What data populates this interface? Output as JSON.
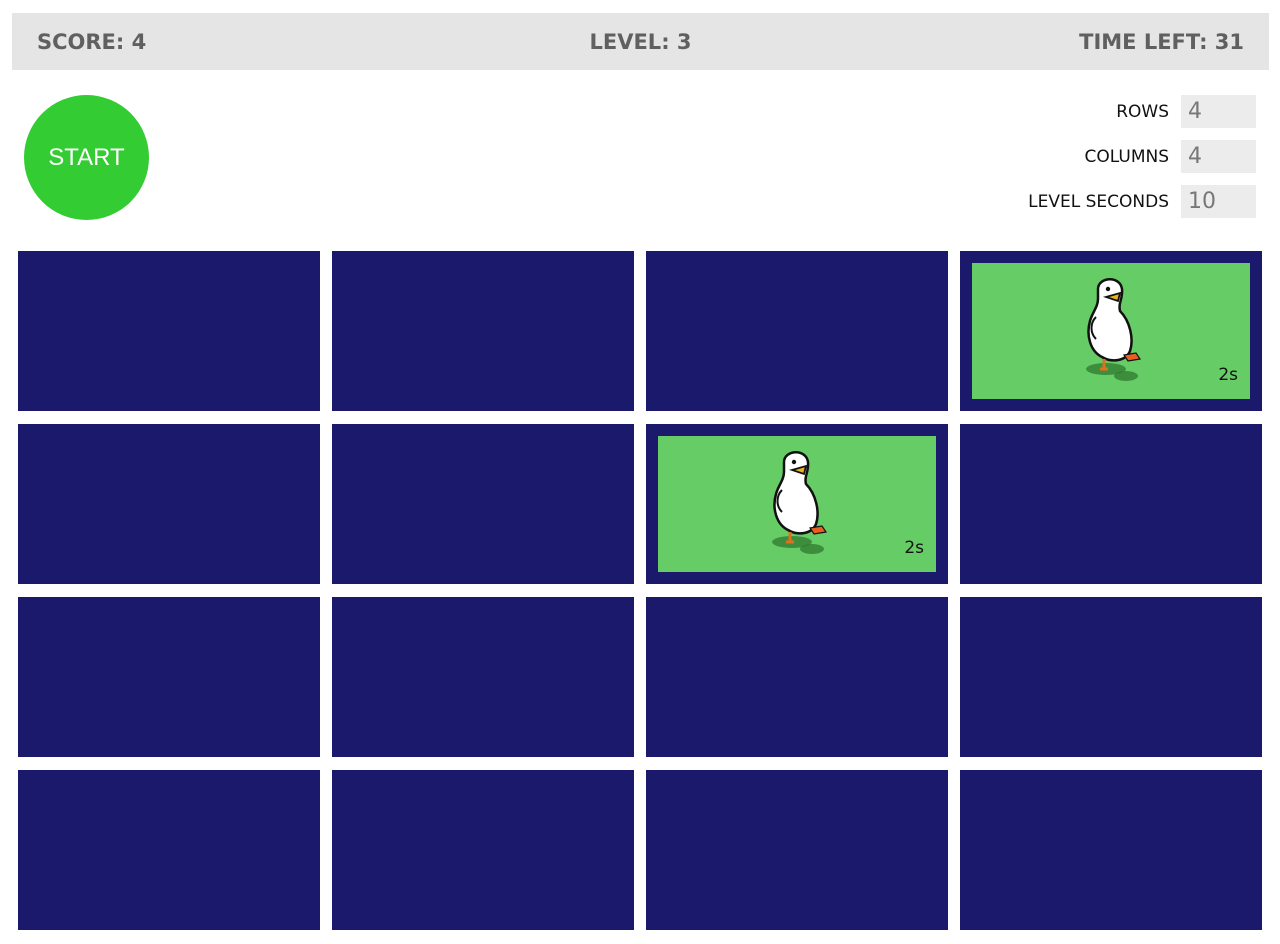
{
  "status": {
    "score": "SCORE: 4",
    "level": "LEVEL: 3",
    "time_left": "TIME LEFT: 31"
  },
  "start_button": {
    "label": "START"
  },
  "settings": {
    "rows": {
      "label": "ROWS",
      "value": "4"
    },
    "columns": {
      "label": "COLUMNS",
      "value": "4"
    },
    "level_seconds": {
      "label": "LEVEL SECONDS",
      "value": "10"
    }
  },
  "board": {
    "rows": 4,
    "columns": 4,
    "tile_color": "#1a196b",
    "revealed_color": "#66cc66",
    "tiles": [
      {
        "revealed": false
      },
      {
        "revealed": false
      },
      {
        "revealed": false
      },
      {
        "revealed": true,
        "image": "duck-icon",
        "timer": "2s"
      },
      {
        "revealed": false
      },
      {
        "revealed": false
      },
      {
        "revealed": true,
        "image": "duck-icon",
        "timer": "2s"
      },
      {
        "revealed": false
      },
      {
        "revealed": false
      },
      {
        "revealed": false
      },
      {
        "revealed": false
      },
      {
        "revealed": false
      },
      {
        "revealed": false
      },
      {
        "revealed": false
      },
      {
        "revealed": false
      },
      {
        "revealed": false
      }
    ]
  },
  "colors": {
    "status_bar": "#e5e5e5",
    "start_button": "#33cc33"
  }
}
